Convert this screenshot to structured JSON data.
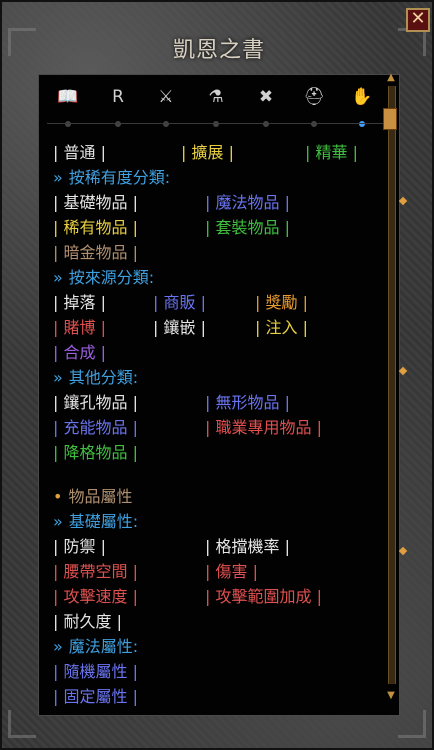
{
  "window": {
    "title": "凱恩之書",
    "close_label": "✕"
  },
  "tabs": [
    {
      "icon": "book-icon",
      "glyph": "📖"
    },
    {
      "icon": "rune-icon",
      "glyph": "R"
    },
    {
      "icon": "warrior-icon",
      "glyph": "⚔"
    },
    {
      "icon": "potion-icon",
      "glyph": "⚗"
    },
    {
      "icon": "crossed-axes-icon",
      "glyph": "✖"
    },
    {
      "icon": "helm-icon",
      "glyph": "⛑"
    },
    {
      "icon": "hand-icon",
      "glyph": "✋"
    }
  ],
  "rarity": {
    "normal": "| 普通 |",
    "expanded": "| 擴展 |",
    "elite": "| 精華 |"
  },
  "by_rarity": {
    "header": "按稀有度分類:",
    "items": [
      "| 基礎物品 |",
      "| 魔法物品 |",
      "| 稀有物品 |",
      "| 套裝物品 |",
      "| 暗金物品 |"
    ]
  },
  "by_source": {
    "header": "按來源分類:",
    "items": [
      "| 掉落 |",
      "| 商販 |",
      "| 獎勵 |",
      "| 賭博 |",
      "| 鑲嵌 |",
      "| 注入 |",
      "| 合成 |"
    ]
  },
  "other": {
    "header": "其他分類:",
    "items": [
      "| 鑲孔物品 |",
      "| 無形物品 |",
      "| 充能物品 |",
      "| 職業專用物品 |",
      "| 降格物品 |"
    ]
  },
  "properties": {
    "title": "物品屬性",
    "basic_header": "基礎屬性:",
    "basic": [
      "| 防禦 |",
      "| 格擋機率 |",
      "| 腰帶空間 |",
      "| 傷害 |",
      "| 攻擊速度 |",
      "| 攻擊範圍加成 |",
      "| 耐久度 |"
    ],
    "magic_header": "魔法屬性:",
    "magic": [
      "| 隨機屬性 |",
      "| 固定屬性 |"
    ]
  },
  "markers": {
    "arrow": "»",
    "dot": "•"
  }
}
